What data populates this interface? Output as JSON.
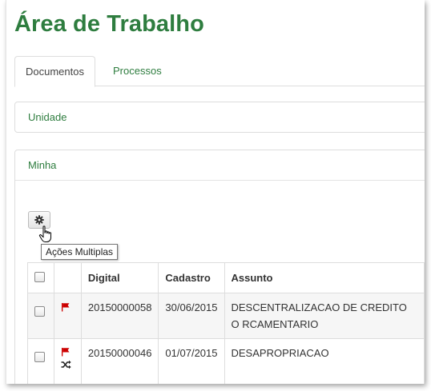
{
  "page": {
    "title": "Área de Trabalho"
  },
  "tabs": [
    {
      "label": "Documentos",
      "active": true
    },
    {
      "label": "Processos",
      "active": false
    }
  ],
  "panels": {
    "unidade": "Unidade",
    "minha": "Minha"
  },
  "toolbar": {
    "tooltip": "Ações Multiplas",
    "icon": "gear-icon"
  },
  "table": {
    "headers": [
      "Digital",
      "Cadastro",
      "Assunto"
    ],
    "rows": [
      {
        "digital": "20150000058",
        "cadastro": "30/06/2015",
        "assunto": "DESCENTRALIZACAO DE CREDITO O RCAMENTARIO",
        "icons": [
          "flag-icon"
        ]
      },
      {
        "digital": "20150000046",
        "cadastro": "01/07/2015",
        "assunto": "DESAPROPRIACAO",
        "icons": [
          "flag-icon",
          "shuffle-icon"
        ]
      }
    ]
  },
  "colors": {
    "accent": "#2e7d3f",
    "flag": "#cc0000"
  }
}
